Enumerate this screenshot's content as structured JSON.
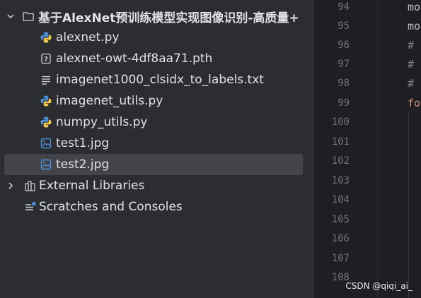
{
  "project": {
    "root_folder": "基于AlexNet预训练模型实现图像识别-高质量+",
    "files": [
      {
        "name": "alexnet.py",
        "icon": "python-file-icon"
      },
      {
        "name": "alexnet-owt-4df8aa71.pth",
        "icon": "unknown-file-icon"
      },
      {
        "name": "imagenet1000_clsidx_to_labels.txt",
        "icon": "text-file-icon"
      },
      {
        "name": "imagenet_utils.py",
        "icon": "python-file-icon"
      },
      {
        "name": "numpy_utils.py",
        "icon": "python-file-icon"
      },
      {
        "name": "test1.jpg",
        "icon": "image-file-icon"
      },
      {
        "name": "test2.jpg",
        "icon": "image-file-icon"
      }
    ],
    "external_libraries": "External Libraries",
    "scratches": "Scratches and Consoles"
  },
  "editor": {
    "line_numbers": [
      "94",
      "95",
      "96",
      "97",
      "98",
      "99",
      "100",
      "101",
      "102",
      "103",
      "104",
      "105",
      "106",
      "107",
      "108"
    ],
    "code": [
      "mo",
      "mo",
      "#",
      "#",
      "#",
      "fo"
    ]
  },
  "watermark": "CSDN @qiqi_ai_",
  "colors": {
    "python_blue": "#4a8fd8",
    "python_yellow": "#f2c94c",
    "image_blue": "#4a8fd8",
    "selection": "#43454a"
  }
}
